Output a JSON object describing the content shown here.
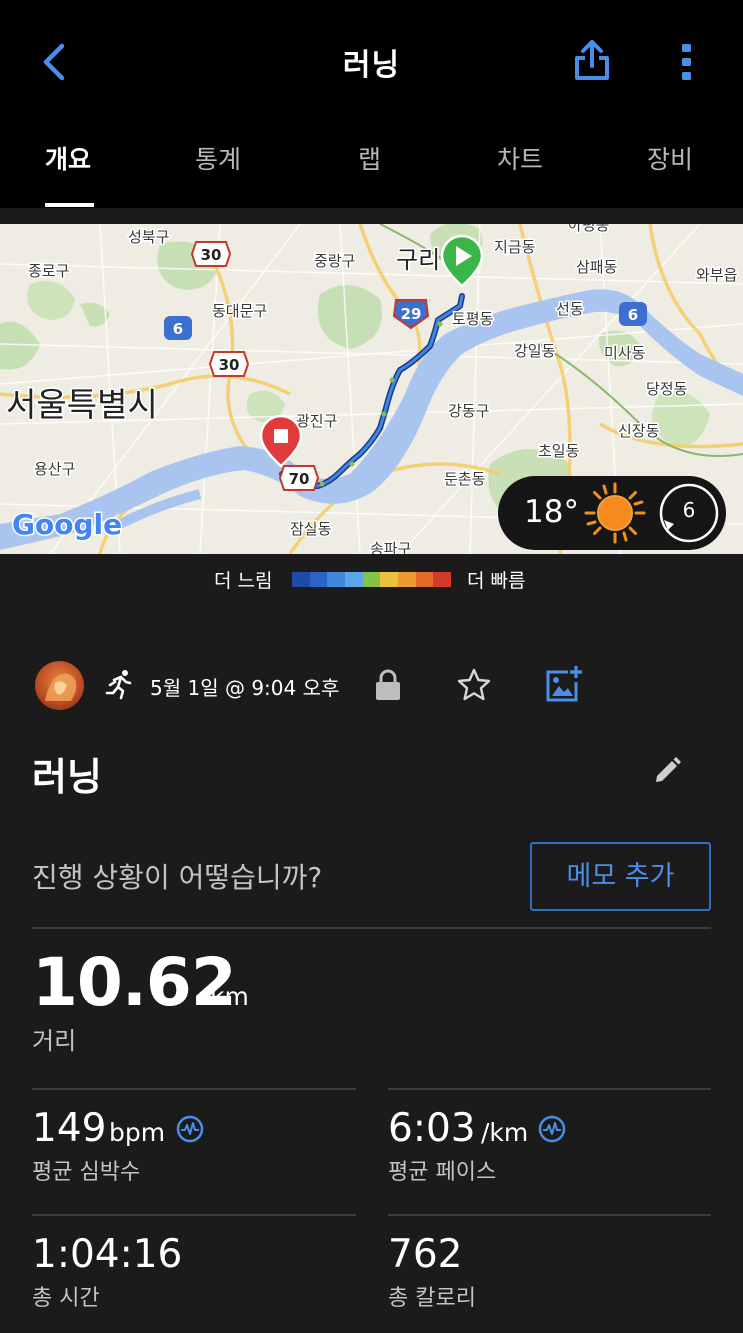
{
  "header": {
    "title": "러닝"
  },
  "tabs": [
    {
      "label": "개요",
      "active": true
    },
    {
      "label": "통계",
      "active": false
    },
    {
      "label": "랩",
      "active": false
    },
    {
      "label": "차트",
      "active": false
    },
    {
      "label": "장비",
      "active": false
    }
  ],
  "map": {
    "labels": {
      "seongbuk": "성북구",
      "jongno": "종로구",
      "jungnang": "중랑구",
      "guri": "구리",
      "jigeum": "지금동",
      "apyeong": "아평동",
      "sampae": "삼패동",
      "wabu": "와부읍",
      "dongdaemun": "동대문구",
      "topyeong": "토평동",
      "seondong": "선동",
      "gangil": "강일동",
      "misa": "미사동",
      "dangjeong": "당정동",
      "seoul": "서울특별시",
      "gwangjin": "광진구",
      "gangdong": "강동구",
      "sinjang": "신장동",
      "yongsan": "용산구",
      "choil": "초일동",
      "dunchon": "둔촌동",
      "jamsil": "잠실동",
      "songpa": "송파구",
      "google": "Google"
    },
    "route_shields": [
      "30",
      "6",
      "30",
      "29",
      "70",
      "6"
    ]
  },
  "weather": {
    "temperature": "18°",
    "wind_speed": "6"
  },
  "legend": {
    "slow": "더 느림",
    "fast": "더 빠름",
    "colors": [
      "#1f4aa8",
      "#2a64c8",
      "#3f86de",
      "#5aa6e6",
      "#86c248",
      "#e8c33a",
      "#ef9a30",
      "#e36b28",
      "#d23a2a"
    ]
  },
  "activity": {
    "date": "5월 1일 @ 9:04 오후",
    "name": "러닝",
    "prompt": "진행 상황이 어떻습니까?",
    "memo_button": "메모 추가"
  },
  "stats": {
    "distance": {
      "value": "10.62",
      "unit": "km",
      "label": "거리"
    },
    "heart_rate": {
      "value": "149",
      "unit": "bpm",
      "label": "평균 심박수"
    },
    "pace": {
      "value": "6:03",
      "unit": "/km",
      "label": "평균 페이스"
    },
    "time": {
      "value": "1:04:16",
      "label": "총 시간"
    },
    "calories": {
      "value": "762",
      "label": "총 칼로리"
    }
  }
}
